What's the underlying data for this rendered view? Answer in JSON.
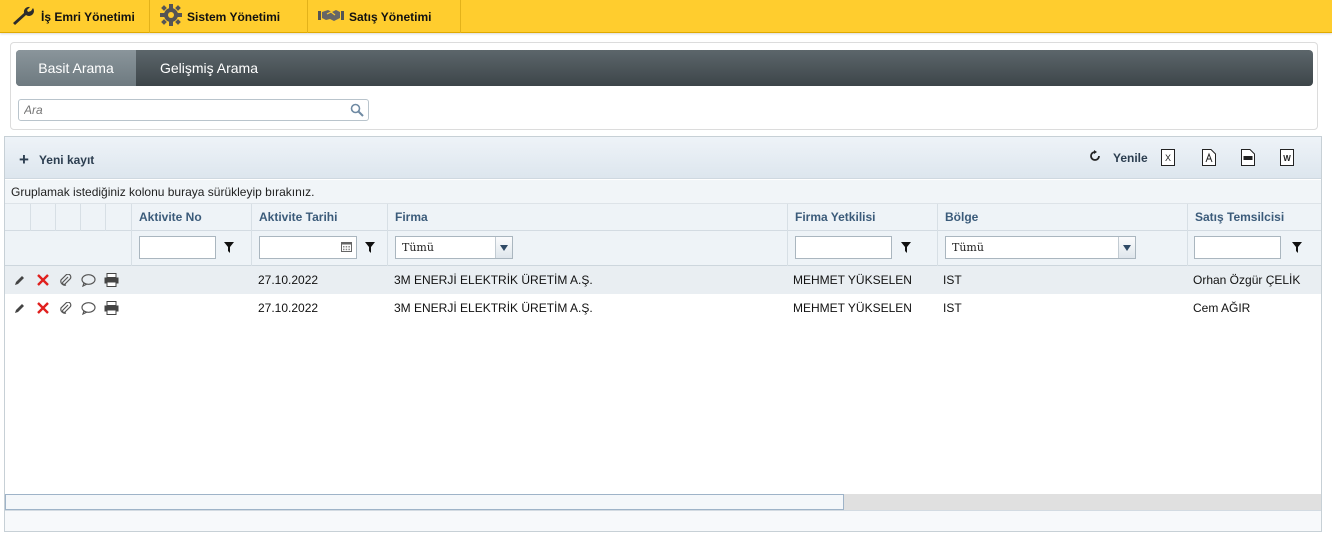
{
  "topmenu": {
    "items": [
      {
        "label": "İş Emri Yönetimi",
        "icon": "wrench-icon"
      },
      {
        "label": "Sistem Yönetimi",
        "icon": "gear-icon"
      },
      {
        "label": "Satış Yönetimi",
        "icon": "handshake-icon"
      }
    ]
  },
  "search": {
    "tabs": [
      {
        "label": "Basit Arama",
        "active": true
      },
      {
        "label": "Gelişmiş Arama",
        "active": false
      }
    ],
    "placeholder": "Ara"
  },
  "toolbar": {
    "new_record": "Yeni kayıt",
    "refresh": "Yenile",
    "exports": [
      "excel-export-icon",
      "pdf-export-icon",
      "csv-export-icon",
      "word-export-icon"
    ]
  },
  "grid": {
    "group_hint": "Gruplamak istediğiniz kolonu buraya sürükleyip bırakınız.",
    "columns": [
      "Aktivite No",
      "Aktivite Tarihi",
      "Firma",
      "Firma Yetkilisi",
      "Bölge",
      "Satış Temsilcisi"
    ],
    "filters": {
      "firma_select": "Tümü",
      "bolge_select": "Tümü"
    },
    "rows": [
      {
        "aktivite_no": "",
        "tarih": "27.10.2022",
        "firma": "3M ENERJİ ELEKTRİK ÜRETİM A.Ş.",
        "yetkili": "MEHMET YÜKSELEN",
        "bolge": "IST",
        "temsilci": "Orhan Özgür ÇELİK"
      },
      {
        "aktivite_no": "",
        "tarih": "27.10.2022",
        "firma": "3M ENERJİ ELEKTRİK ÜRETİM A.Ş.",
        "yetkili": "MEHMET YÜKSELEN",
        "bolge": "IST",
        "temsilci": "Cem AĞIR"
      }
    ]
  },
  "colors": {
    "topbar": "#ffcd2e",
    "tabstrip": "#3d4549",
    "header_text": "#3b5b7a"
  }
}
